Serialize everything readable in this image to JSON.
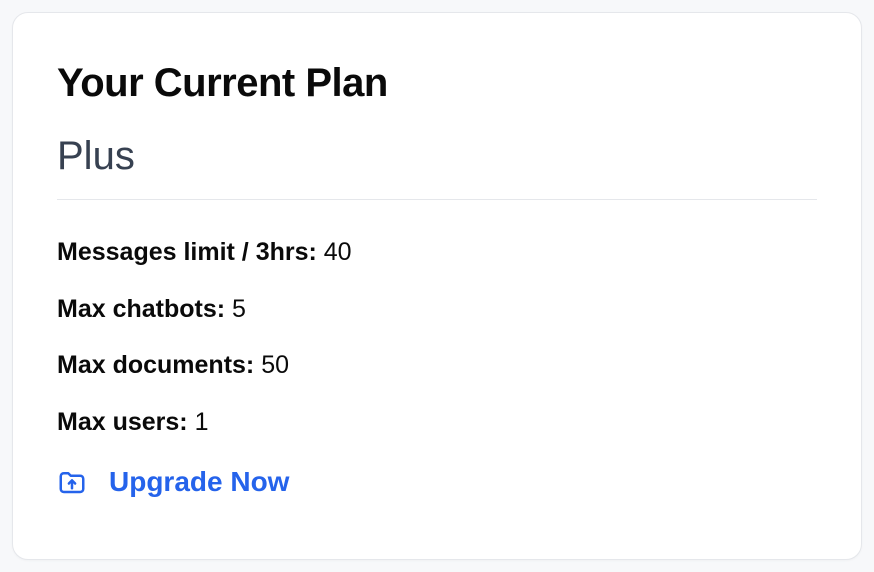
{
  "card": {
    "title": "Your Current Plan",
    "plan_name": "Plus",
    "details": {
      "messages_limit_label": "Messages limit / 3hrs:",
      "messages_limit_value": "40",
      "max_chatbots_label": "Max chatbots:",
      "max_chatbots_value": "5",
      "max_documents_label": "Max documents:",
      "max_documents_value": "50",
      "max_users_label": "Max users:",
      "max_users_value": "1"
    },
    "upgrade_label": "Upgrade Now"
  }
}
